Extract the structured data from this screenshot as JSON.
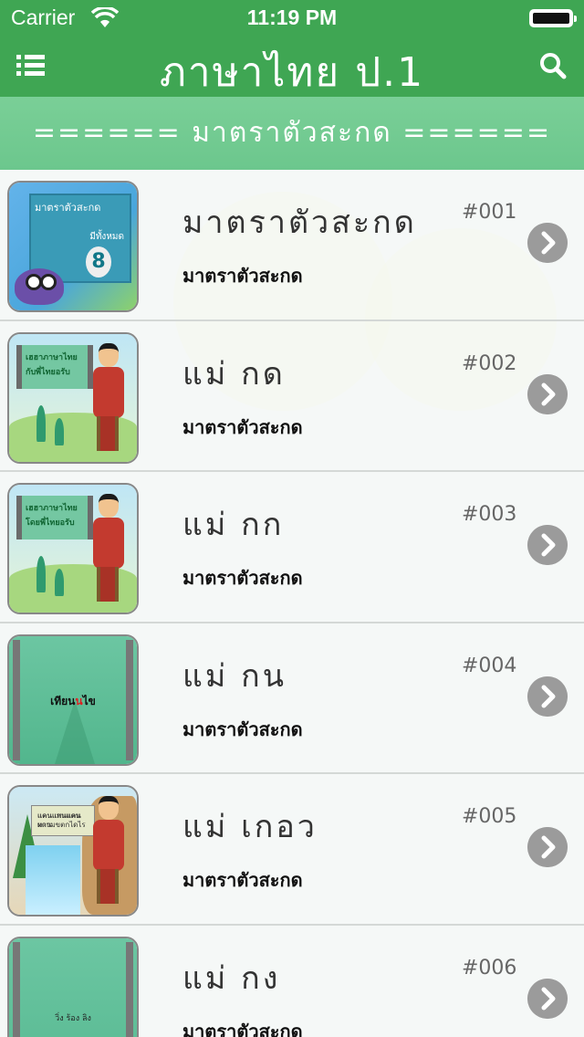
{
  "status_bar": {
    "carrier": "Carrier",
    "time": "11:19 PM"
  },
  "nav": {
    "title": "ภาษาไทย  ป.1",
    "menu_icon": "list-menu-icon",
    "search_icon": "search-icon"
  },
  "section_header": "======  มาตราตัวสะกด  ======",
  "colors": {
    "nav_green": "#3fa653",
    "header_green": "#72cb92",
    "chevron_gray": "#9b9b9b"
  },
  "lessons": [
    {
      "title": "มาตราตัวสะกด",
      "subtitle": "มาตราตัวสะกด",
      "code": "#001",
      "thumb": {
        "line1": "มาตราตัวสะกด",
        "line2": "มีทั้งหมด",
        "number": "8"
      }
    },
    {
      "title": "แม่  กด",
      "subtitle": "มาตราตัวสะกด",
      "code": "#002",
      "thumb": {
        "line1": "เฮฮาภาษาไทย",
        "line2": "กับพี่ไทยอรับ"
      }
    },
    {
      "title": "แม่  กก",
      "subtitle": "มาตราตัวสะกด",
      "code": "#003",
      "thumb": {
        "line1": "เฮฮาภาษาไทย",
        "line2": "โดยพี่ไทยอรับ"
      }
    },
    {
      "title": "แม่  กน",
      "subtitle": "มาตราตัวสะกด",
      "code": "#004",
      "thumb": {
        "word_start": "เทียน",
        "word_mid": "น",
        "word_end": "ไข"
      }
    },
    {
      "title": "แม่  เกอว",
      "subtitle": "มาตราตัวสะกด",
      "code": "#005",
      "thumb": {
        "line1": "แคนแพนแคนทาน",
        "line2": "แดนแกนแดนผดามขตกไดไร"
      }
    },
    {
      "title": "แม่  กง",
      "subtitle": "มาตราตัวสะกด",
      "code": "#006",
      "thumb": {
        "line1": "วิ่ง  ร้อง  ลิง"
      }
    }
  ]
}
